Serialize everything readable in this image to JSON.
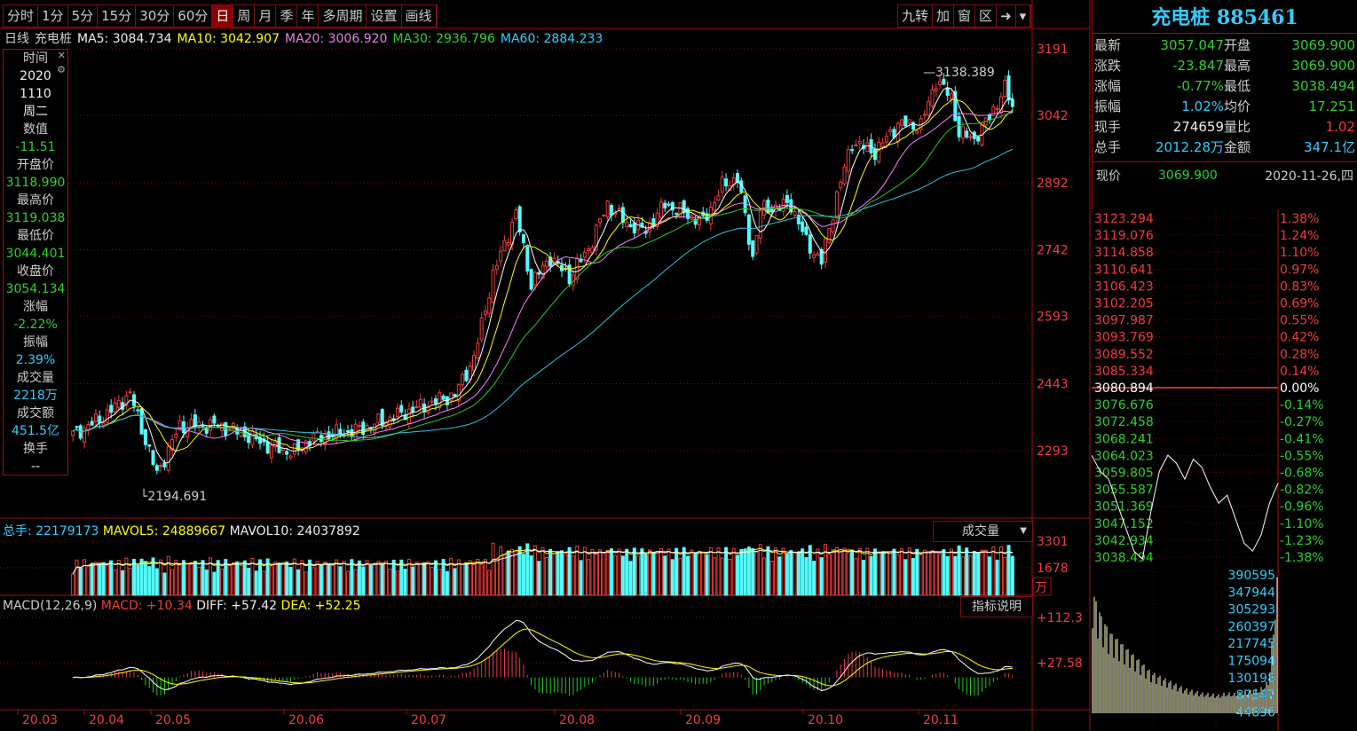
{
  "toolbar": {
    "periods": [
      "分时",
      "1分",
      "5分",
      "15分",
      "30分",
      "60分",
      "日",
      "周",
      "月",
      "季",
      "年",
      "多周期",
      "设置",
      "画线"
    ],
    "active": "日",
    "tools": [
      "九转",
      "加",
      "窗",
      "区"
    ]
  },
  "ma_line": {
    "period": "日线",
    "name": "充电桩",
    "ma5": "MA5: 3084.734",
    "ma10": "MA10: 3042.907",
    "ma20": "MA20: 3006.920",
    "ma30": "MA30: 2936.796",
    "ma60": "MA60: 2884.233"
  },
  "info_panel": {
    "rows": [
      [
        "时间",
        "2020"
      ],
      [
        "",
        "1110"
      ],
      [
        "",
        "周二"
      ],
      [
        "数值",
        "-11.51"
      ],
      [
        "开盘价",
        "3118.990"
      ],
      [
        "最高价",
        "3119.038"
      ],
      [
        "最低价",
        "3044.401"
      ],
      [
        "收盘价",
        "3054.134"
      ],
      [
        "涨幅",
        "-2.22%"
      ],
      [
        "振幅",
        "2.39%"
      ],
      [
        "成交量",
        "2218万"
      ],
      [
        "成交额",
        "451.5亿"
      ],
      [
        "换手",
        "--"
      ]
    ]
  },
  "colors": {
    "up": "#f03c3c",
    "down": "#54fcfc",
    "ma5": "#ffffff",
    "ma10": "#ffff00",
    "ma20": "#ff80ff",
    "ma30": "#22cc22",
    "ma60": "#2ec4e0",
    "grid": "#7a1010"
  },
  "chart_data": {
    "type": "candlestick",
    "price_ticks": [
      "3191",
      "3042",
      "2892",
      "2742",
      "2593",
      "2443",
      "2293"
    ],
    "price_tick_values": [
      3191,
      3042,
      2892,
      2742,
      2593,
      2443,
      2293
    ],
    "ylim": [
      2194,
      3191
    ],
    "annotations": {
      "high": "3138.389",
      "low": "2194.691"
    },
    "x_ticks": [
      "20.03",
      "20.04",
      "20.05",
      "20.06",
      "20.07",
      "20.08",
      "20.09",
      "20.10",
      "20.11"
    ],
    "close_path": [
      [
        0,
        2329
      ],
      [
        8,
        2368
      ],
      [
        15,
        2420
      ],
      [
        22,
        2240
      ],
      [
        28,
        2349
      ],
      [
        38,
        2350
      ],
      [
        45,
        2330
      ],
      [
        52,
        2300
      ],
      [
        58,
        2289
      ],
      [
        62,
        2320
      ],
      [
        75,
        2340
      ],
      [
        90,
        2388
      ],
      [
        100,
        2418
      ],
      [
        105,
        2500
      ],
      [
        110,
        2686
      ],
      [
        116,
        2824
      ],
      [
        120,
        2666
      ],
      [
        125,
        2725
      ],
      [
        130,
        2680
      ],
      [
        135,
        2745
      ],
      [
        140,
        2844
      ],
      [
        145,
        2800
      ],
      [
        150,
        2785
      ],
      [
        155,
        2844
      ],
      [
        165,
        2804
      ],
      [
        170,
        2884
      ],
      [
        174,
        2904
      ],
      [
        178,
        2725
      ],
      [
        180,
        2830
      ],
      [
        188,
        2844
      ],
      [
        192,
        2760
      ],
      [
        196,
        2715
      ],
      [
        200,
        2864
      ],
      [
        204,
        2983
      ],
      [
        210,
        2960
      ],
      [
        216,
        3023
      ],
      [
        222,
        3020
      ],
      [
        226,
        3121
      ],
      [
        230,
        3082
      ],
      [
        232,
        3003
      ],
      [
        236,
        2990
      ],
      [
        240,
        3040
      ],
      [
        244,
        3102
      ],
      [
        246,
        3062
      ]
    ],
    "volume": {
      "label": "总手: 22179173",
      "mavol5": "MAVOL5: 24889667",
      "mavol10": "MAVOL10: 24037892",
      "ticks": [
        "3301",
        "1678"
      ],
      "unit": "万",
      "selector": "成交量"
    },
    "macd": {
      "label": "MACD(12,26,9)",
      "macd": "MACD: +10.34",
      "diff": "DIFF: +57.42",
      "dea": "DEA: +52.25",
      "ticks": [
        "+112.3",
        "+27.58"
      ],
      "help": "指标说明"
    }
  },
  "quote": {
    "title": "充电桩 885461",
    "rows": [
      [
        "最新",
        "3057.047",
        "开盘",
        "3069.900"
      ],
      [
        "涨跌",
        "-23.847",
        "最高",
        "3069.900"
      ],
      [
        "涨幅",
        "-0.77%",
        "最低",
        "3038.494"
      ],
      [
        "振幅",
        "1.02%",
        "均价",
        "17.251"
      ],
      [
        "现手",
        "274659",
        "量比",
        "1.02"
      ],
      [
        "总手",
        "2012.28万",
        "金额",
        "347.1亿"
      ]
    ],
    "now_label": "现价",
    "now_value": "3069.900",
    "date": "2020-11-26,四"
  },
  "intraday": {
    "prices": [
      "3123.294",
      "3119.076",
      "3114.858",
      "3110.641",
      "3106.423",
      "3102.205",
      "3097.987",
      "3093.769",
      "3089.552",
      "3085.334",
      "3080.894",
      "3076.676",
      "3072.458",
      "3068.241",
      "3064.023",
      "3059.805",
      "3055.587",
      "3051.369",
      "3047.152",
      "3042.934",
      "3038.494"
    ],
    "pcts": [
      "1.38%",
      "1.24%",
      "1.10%",
      "0.97%",
      "0.83%",
      "0.69%",
      "0.55%",
      "0.42%",
      "0.28%",
      "0.14%",
      "0.00%",
      "-0.14%",
      "-0.27%",
      "-0.41%",
      "-0.55%",
      "-0.68%",
      "-0.82%",
      "-0.96%",
      "-1.10%",
      "-1.23%",
      "-1.38%"
    ],
    "vol_ticks": [
      "390595",
      "347944",
      "305293",
      "260397",
      "217745",
      "175094",
      "130198",
      "87547",
      "44896"
    ],
    "path": [
      3064,
      3060,
      3058,
      3052,
      3046,
      3040,
      3038,
      3050,
      3060,
      3064,
      3062,
      3058,
      3063,
      3061,
      3056,
      3052,
      3054,
      3048,
      3042,
      3040,
      3044,
      3052,
      3057
    ],
    "vols": [
      300000,
      240000,
      200000,
      180000,
      160000,
      140000,
      120000,
      100000,
      90000,
      80000,
      70000,
      60000,
      55000,
      50000,
      48000,
      45000,
      50000,
      48000,
      52000,
      55000,
      60000,
      80000,
      320000
    ]
  }
}
